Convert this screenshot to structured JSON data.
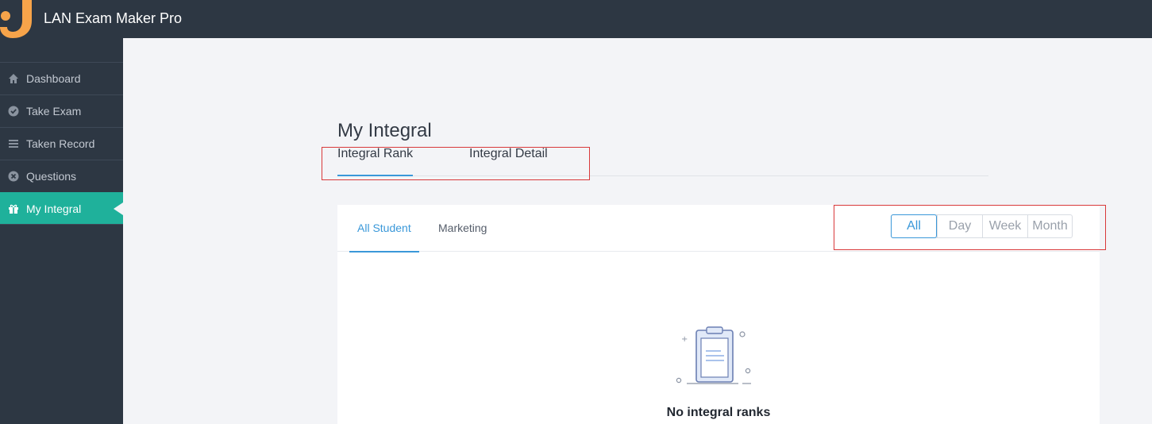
{
  "app": {
    "title": "LAN Exam Maker Pro"
  },
  "sidebar": {
    "items": [
      {
        "label": "Dashboard",
        "icon": "home-icon"
      },
      {
        "label": "Take Exam",
        "icon": "check-circle-icon"
      },
      {
        "label": "Taken Record",
        "icon": "list-icon"
      },
      {
        "label": "Questions",
        "icon": "x-circle-icon"
      },
      {
        "label": "My Integral",
        "icon": "gift-icon",
        "active": true
      }
    ]
  },
  "page": {
    "title": "My Integral",
    "tabs": [
      {
        "label": "Integral Rank",
        "active": true
      },
      {
        "label": "Integral Detail"
      }
    ]
  },
  "rank": {
    "tabs": [
      {
        "label": "All Student",
        "active": true
      },
      {
        "label": "Marketing"
      }
    ],
    "periods": [
      {
        "label": "All",
        "active": true
      },
      {
        "label": "Day"
      },
      {
        "label": "Week"
      },
      {
        "label": "Month"
      }
    ],
    "empty_text": "No integral ranks"
  },
  "colors": {
    "topbar": "#2d3743",
    "active_menu": "#1fb19b",
    "accent": "#3a98d9",
    "highlight": "#d9393a",
    "logo": "#f7a44a"
  }
}
